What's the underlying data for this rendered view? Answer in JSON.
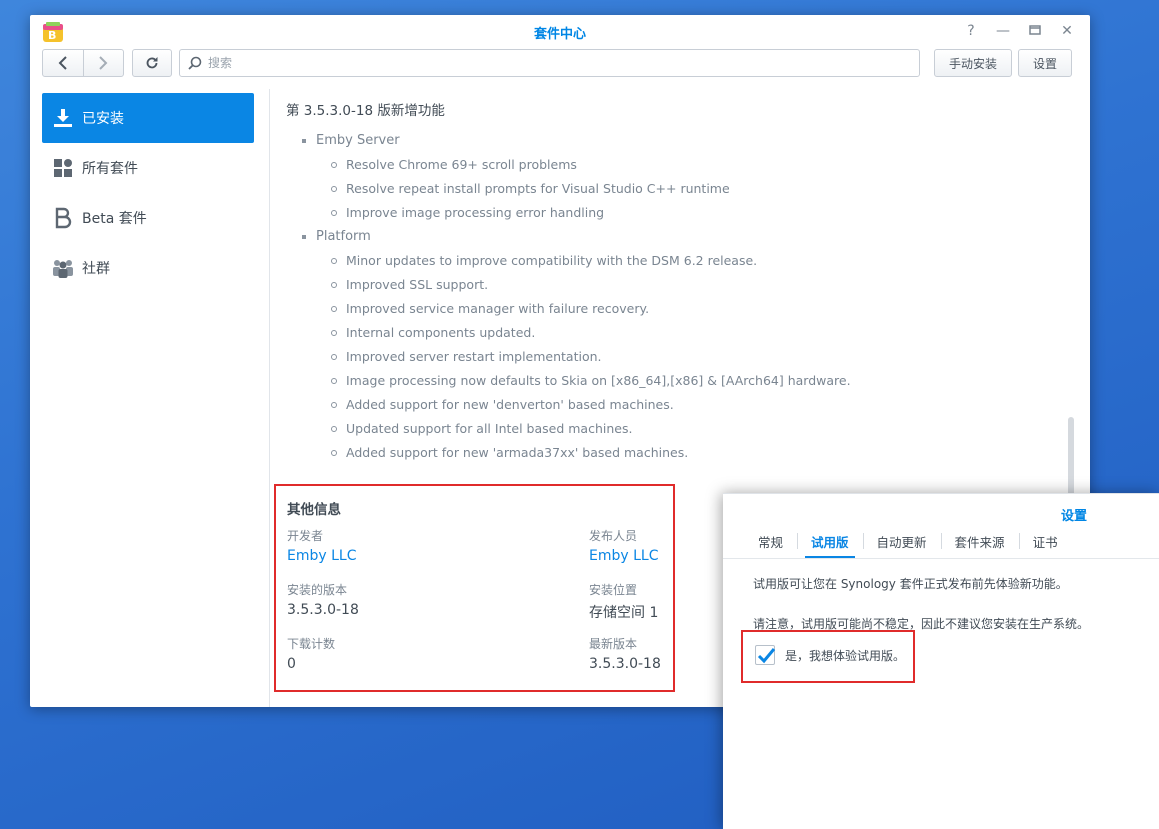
{
  "window": {
    "title": "套件中心",
    "icon": "package-center-icon",
    "controls": [
      "help-icon",
      "minimize-icon",
      "maximize-icon",
      "close-icon"
    ]
  },
  "toolbar": {
    "search_placeholder": "搜索",
    "manual_install_label": "手动安装",
    "settings_label": "设置"
  },
  "sidebar": {
    "items": [
      {
        "label": "已安装",
        "icon": "download-icon",
        "active": true
      },
      {
        "label": "所有套件",
        "icon": "grid-icon",
        "active": false
      },
      {
        "label": "Beta 套件",
        "icon": "beta-icon",
        "active": false
      },
      {
        "label": "社群",
        "icon": "community-icon",
        "active": false
      }
    ]
  },
  "changelog": {
    "title": "第 3.5.3.0-18 版新增功能",
    "groups": [
      {
        "name": "Emby Server",
        "items": [
          "Resolve Chrome 69+ scroll problems",
          "Resolve repeat install prompts for Visual Studio C++ runtime",
          "Improve image processing error handling"
        ]
      },
      {
        "name": "Platform",
        "items": [
          "Minor updates to improve compatibility with the DSM 6.2 release.",
          "Improved SSL support.",
          "Improved service manager with failure recovery.",
          "Internal components updated.",
          "Improved server restart implementation.",
          "Image processing now defaults to Skia on [x86_64],[x86] & [AArch64] hardware.",
          "Added support for new 'denverton' based machines.",
          "Updated support for all Intel based machines.",
          "Added support for new 'armada37xx' based machines."
        ]
      }
    ]
  },
  "other_info": {
    "title": "其他信息",
    "developer_label": "开发者",
    "developer_value": "Emby LLC",
    "publisher_label": "发布人员",
    "publisher_value": "Emby LLC",
    "installed_version_label": "安装的版本",
    "installed_version_value": "3.5.3.0-18",
    "install_location_label": "安装位置",
    "install_location_value": "存储空间 1",
    "downloads_label": "下载计数",
    "downloads_value": "0",
    "latest_version_label": "最新版本",
    "latest_version_value": "3.5.3.0-18"
  },
  "settings_dialog": {
    "title": "设置",
    "tabs": [
      {
        "label": "常规",
        "active": false
      },
      {
        "label": "试用版",
        "active": true
      },
      {
        "label": "自动更新",
        "active": false
      },
      {
        "label": "套件来源",
        "active": false
      },
      {
        "label": "证书",
        "active": false
      }
    ],
    "description": "试用版可让您在 Synology 套件正式发布前先体验新功能。",
    "warning": "请注意，试用版可能尚不稳定，因此不建议您安装在生产系统。",
    "checkbox_label": "是，我想体验试用版。",
    "checkbox_checked": true
  },
  "colors": {
    "accent": "#0a86e4",
    "highlight_border": "#e02b2b",
    "desktop": "#2f73d2"
  }
}
